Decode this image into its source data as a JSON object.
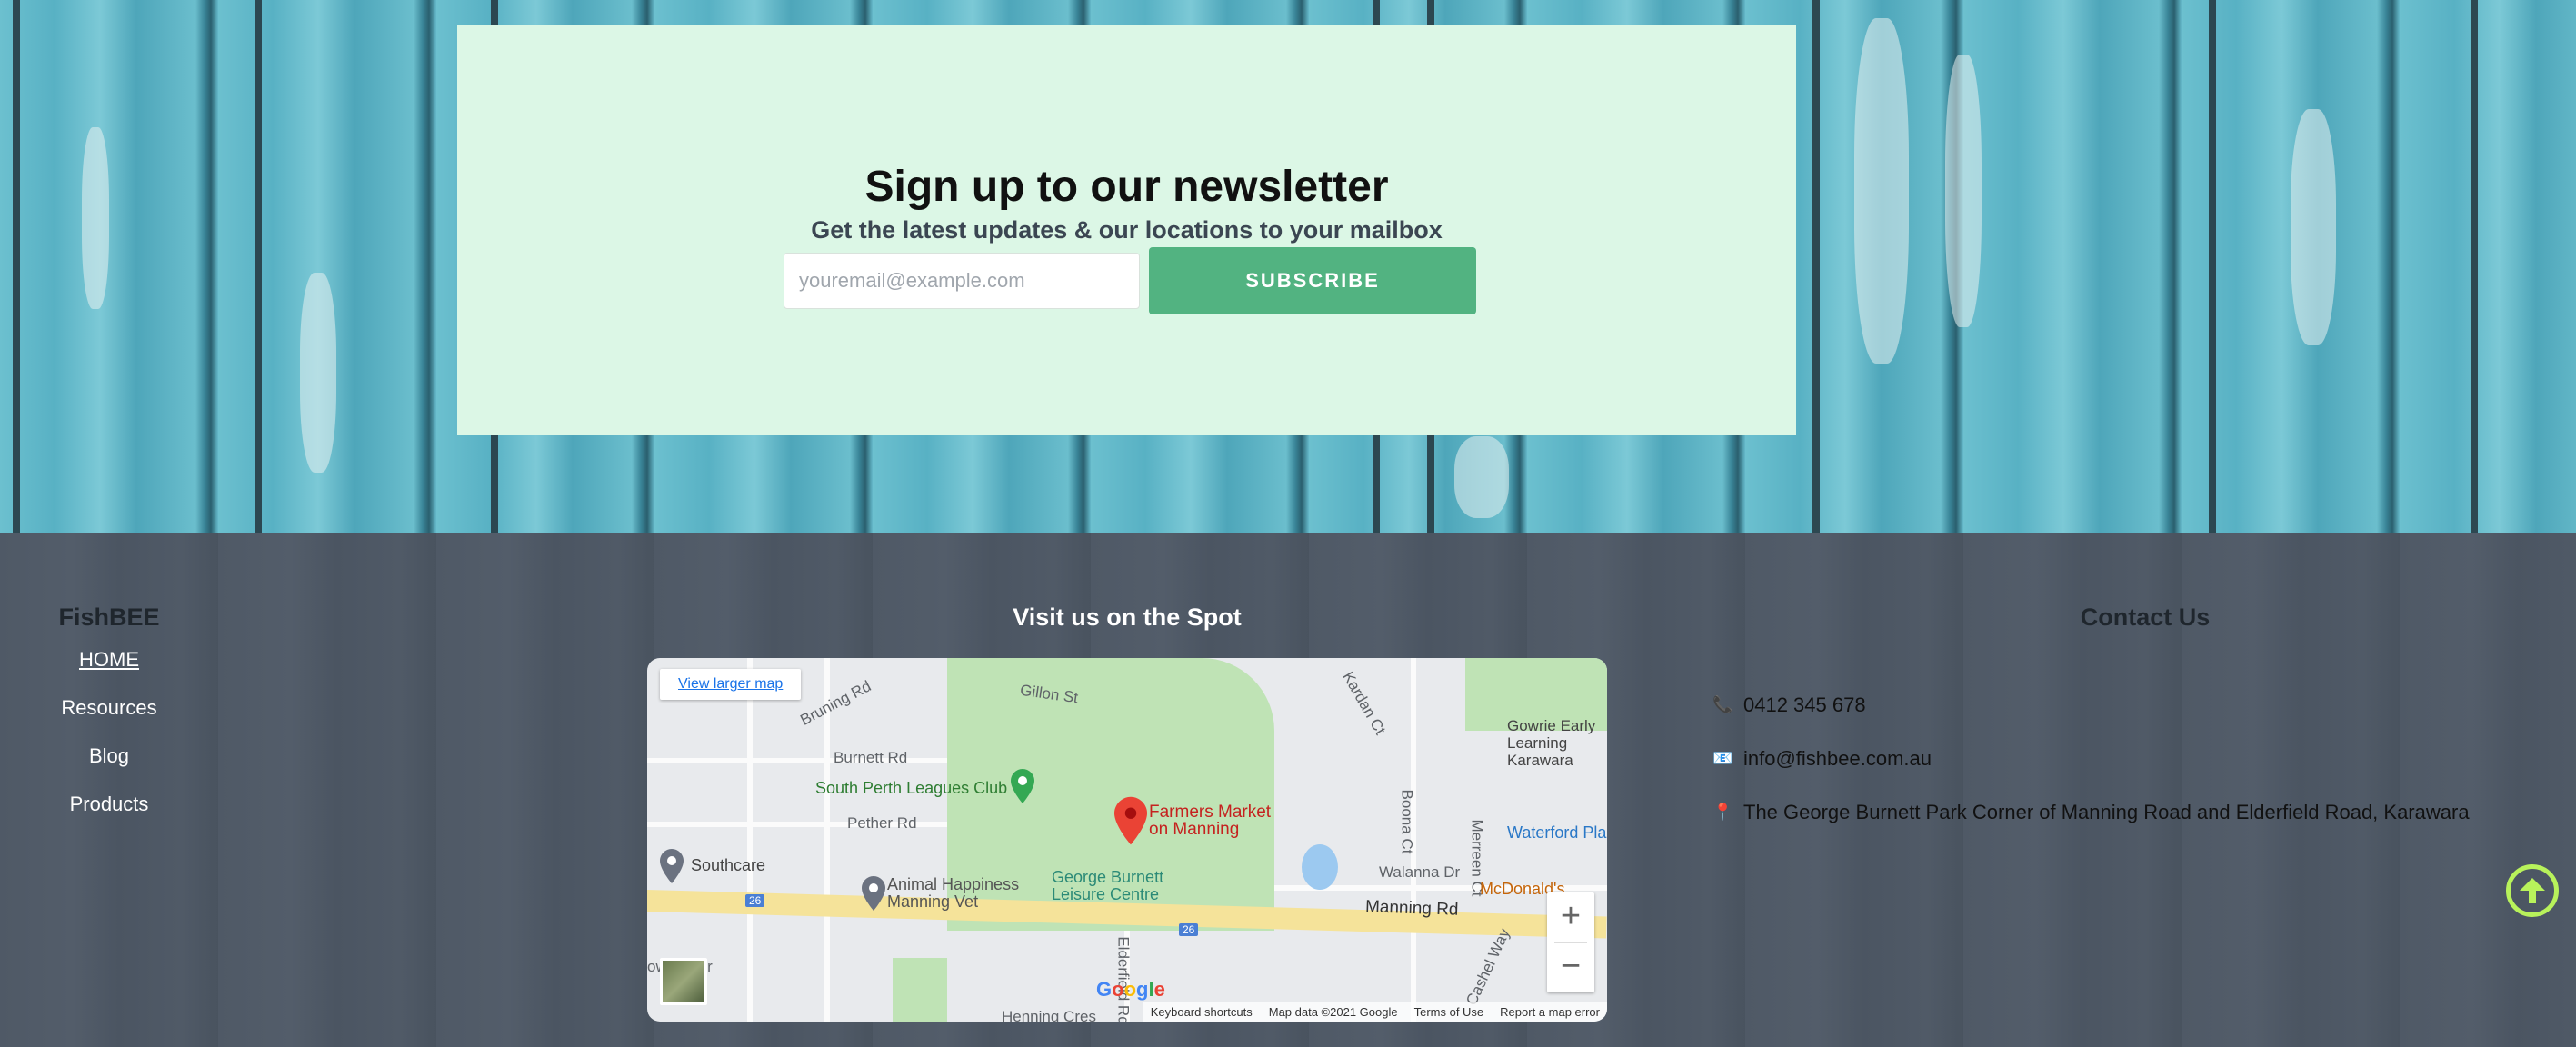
{
  "newsletter": {
    "title": "Sign up to our newsletter",
    "subtitle": "Get the latest updates & our locations to your mailbox",
    "email_placeholder": "youremail@example.com",
    "subscribe_label": "SUBSCRIBE"
  },
  "footer": {
    "brand": "FishBEE",
    "nav": [
      {
        "label": "HOME",
        "active": true
      },
      {
        "label": "Resources"
      },
      {
        "label": "Blog"
      },
      {
        "label": "Products"
      }
    ],
    "visit_title": "Visit us on the Spot",
    "map": {
      "view_larger": "View larger map",
      "pin_label_1": "Farmers Market",
      "pin_label_2": "on Manning",
      "places": {
        "south_perth": "South Perth Leagues Club",
        "southcare": "Southcare",
        "animal_1": "Animal Happiness",
        "animal_2": "Manning Vet",
        "george_1": "George Burnett",
        "george_2": "Leisure Centre",
        "gowrie_1": "Gowrie Early",
        "gowrie_2": "Learning Karawara",
        "waterford": "Waterford Pla",
        "mcdonalds": "McDonald's",
        "manning_rd": "Manning Rd",
        "burnett_rd": "Burnett Rd",
        "pether_rd": "Pether Rd",
        "bruning_rd": "Bruning Rd",
        "gillon_st": "Gillon St",
        "kardan_ct": "Kardan Ct",
        "walanna_dr": "Walanna Dr",
        "boona_ct": "Boona Ct",
        "merreen_ct": "Merreen Ct",
        "cashel_way": "Cashel Way",
        "elderfield_rd": "Elderfield Rd",
        "downey_dr": "owney Dr",
        "henning_cres": "Henning Cres",
        "route_26": "26"
      },
      "google": "Google",
      "attribution": [
        "Keyboard shortcuts",
        "Map data ©2021 Google",
        "Terms of Use",
        "Report a map error"
      ]
    },
    "contact": {
      "title": "Contact Us",
      "phone": "0412 345 678",
      "email": "info@fishbee.com.au",
      "address": "The George Burnett Park Corner of Manning Road and Elderfield Road, Karawara",
      "phone_icon": "phone-icon",
      "email_icon": "envelope-icon",
      "address_icon": "map-pin-icon"
    }
  },
  "colors": {
    "accent_green": "#52b381",
    "newsletter_bg": "#dcf7e6",
    "back_to_top": "#b8f25b"
  }
}
